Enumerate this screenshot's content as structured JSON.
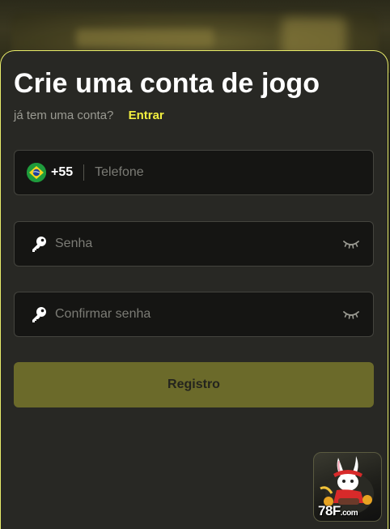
{
  "form": {
    "title": "Crie uma conta de jogo",
    "have_account_text": "já tem uma conta?",
    "login_link": "Entrar",
    "phone": {
      "country_code": "+55",
      "placeholder": "Telefone",
      "flag_icon": "brazil-flag-icon"
    },
    "password": {
      "placeholder": "Senha",
      "icon": "key-icon",
      "toggle_icon": "eye-closed-icon"
    },
    "confirm_password": {
      "placeholder": "Confirmar senha",
      "icon": "key-icon",
      "toggle_icon": "eye-closed-icon"
    },
    "submit_label": "Registro"
  },
  "brand": {
    "logo_main": "78F",
    "logo_suffix": ".com"
  },
  "colors": {
    "accent": "#f2ef3f",
    "panel_border": "#e8ec6a",
    "button_bg": "#6b6a2a",
    "panel_bg": "#282824",
    "field_bg": "#151513"
  }
}
